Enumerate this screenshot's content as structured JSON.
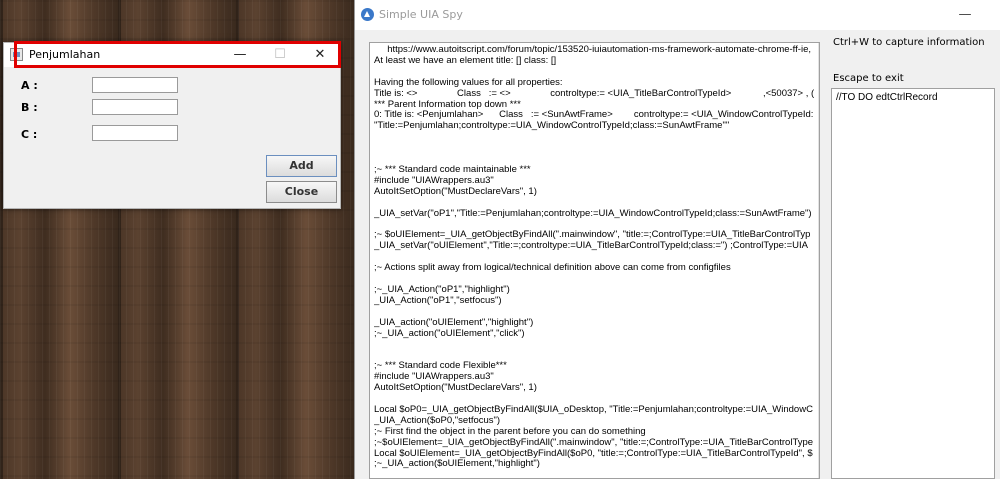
{
  "app_window": {
    "title": "Penjumlahan",
    "minimize_glyph": "—",
    "maximize_glyph": "☐",
    "close_glyph": "✕",
    "icon": "java-app-icon",
    "fields": [
      {
        "label": "A :",
        "value": ""
      },
      {
        "label": "B :",
        "value": ""
      },
      {
        "label": "C :",
        "value": ""
      }
    ],
    "add_button": "Add",
    "close_button": "Close"
  },
  "highlight": {
    "color": "#e00000"
  },
  "spy_window": {
    "title": "Simple UIA Spy",
    "icon": "uia-spy-icon",
    "minimize_glyph": "—",
    "code_lines": [
      "     https://www.autoitscript.com/forum/topic/153520-iuiautomation-ms-framework-automate-chrome-ff-ie,",
      "At least we have an element title: [] class: []",
      "",
      "Having the following values for all properties:",
      "Title is: <>               Class   := <>               controltype:= <UIA_TitleBarControlTypeId>            ,<50037> , (",
      "*** Parent Information top down ***",
      "0: Title is: <Penjumlahan>      Class   := <SunAwtFrame>        controltype:= <UIA_WindowControlTypeId:",
      "\"Title:=Penjumlahan;controltype:=UIA_WindowControlTypeId;class:=SunAwtFrame\"\"",
      "",
      "",
      "",
      ";~ *** Standard code maintainable ***",
      "#include \"UIAWrappers.au3\"",
      "AutoItSetOption(\"MustDeclareVars\", 1)",
      "",
      "_UIA_setVar(\"oP1\",\"Title:=Penjumlahan;controltype:=UIA_WindowControlTypeId;class:=SunAwtFrame\")",
      "",
      ";~ $oUIElement=_UIA_getObjectByFindAll(\".mainwindow\", \"title:=;ControlType:=UIA_TitleBarControlTyp",
      "_UIA_setVar(\"oUIElement\",\"Title:=;controltype:=UIA_TitleBarControlTypeId;class:=\") ;ControlType:=UIA",
      "",
      ";~ Actions split away from logical/technical definition above can come from configfiles",
      "",
      ";~_UIA_Action(\"oP1\",\"highlight\")",
      "_UIA_Action(\"oP1\",\"setfocus\")",
      "",
      "_UIA_action(\"oUIElement\",\"highlight\")",
      ";~_UIA_action(\"oUIElement\",\"click\")",
      "",
      "",
      ";~ *** Standard code Flexible***",
      "#include \"UIAWrappers.au3\"",
      "AutoItSetOption(\"MustDeclareVars\", 1)",
      "",
      "Local $oP0=_UIA_getObjectByFindAll($UIA_oDesktop, \"Title:=Penjumlahan;controltype:=UIA_WindowC",
      "_UIA_Action($oP0,\"setfocus\")",
      ";~ First find the object in the parent before you can do something",
      ";~$oUIElement=_UIA_getObjectByFindAll(\".mainwindow\", \"title:=;ControlType:=UIA_TitleBarControlType",
      "Local $oUIElement=_UIA_getObjectByFindAll($oP0, \"title:=;ControlType:=UIA_TitleBarControlTypeId\", $",
      ";~_UIA_action($oUIElement,\"highlight\")"
    ],
    "hint_capture": "Ctrl+W to capture information",
    "hint_escape": "Escape to exit",
    "side_text": "//TO DO edtCtrlRecord"
  }
}
